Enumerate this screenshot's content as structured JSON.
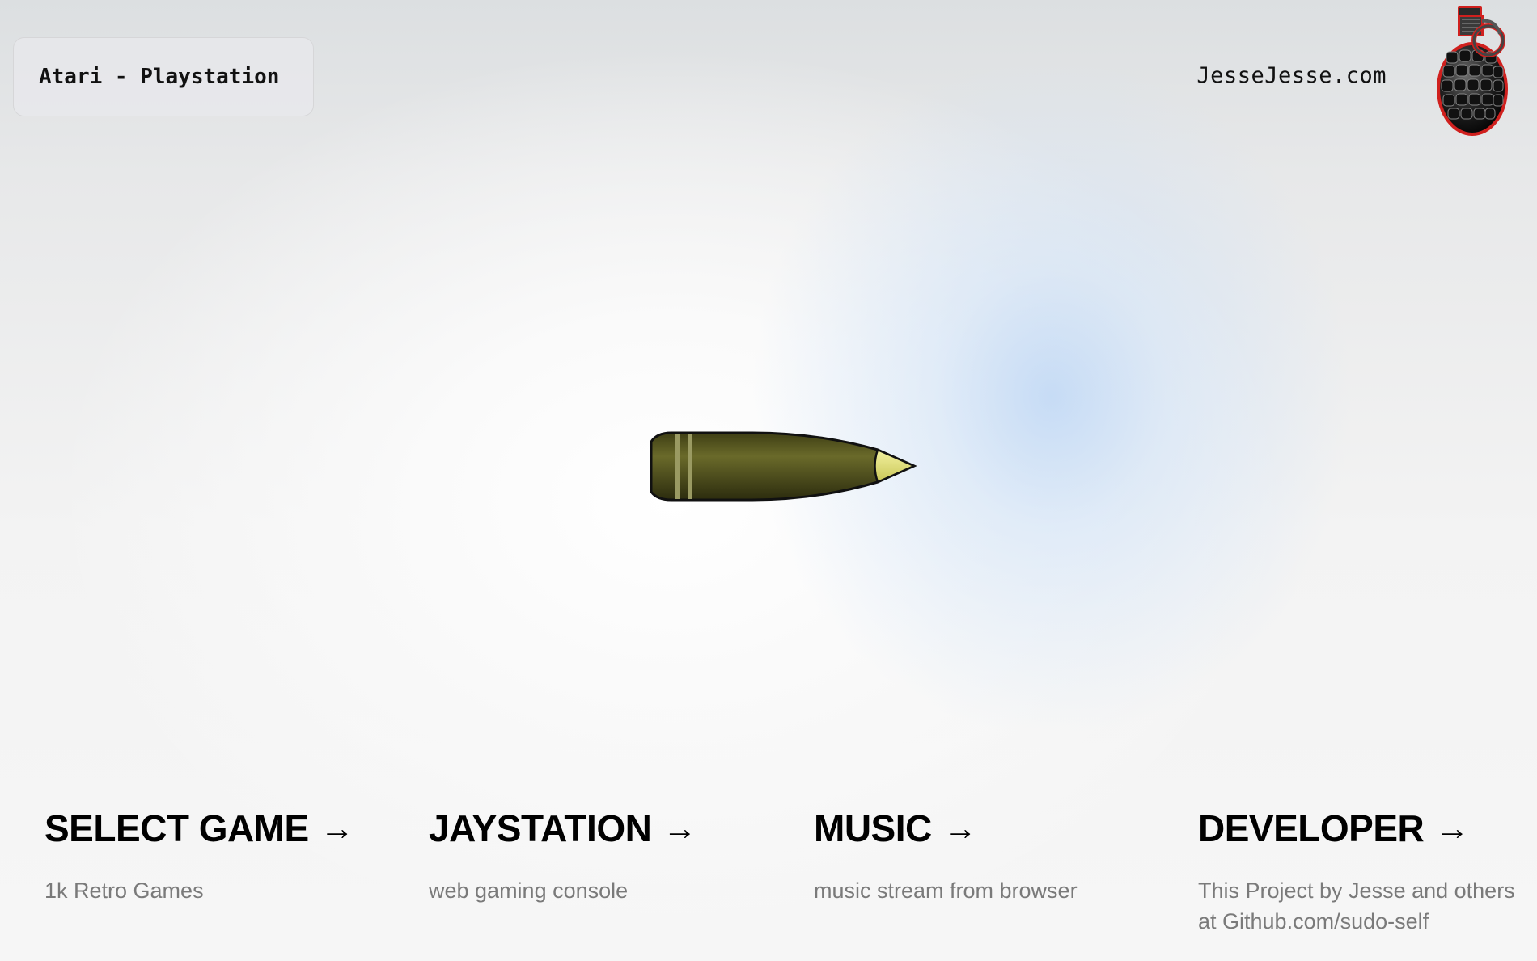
{
  "header": {
    "title": "Atari - Playstation",
    "site_link": "JesseJesse.com",
    "logo_icon": "grenade-icon"
  },
  "hero": {
    "icon": "bullet-icon"
  },
  "cards": [
    {
      "title": "SELECT GAME",
      "arrow": "→",
      "description": "1k Retro Games"
    },
    {
      "title": "JAYSTATION",
      "arrow": "→",
      "description": "web gaming console"
    },
    {
      "title": "MUSIC",
      "arrow": "→",
      "description": "music stream from browser"
    },
    {
      "title": "DEVELOPER",
      "arrow": "→",
      "description": "This Project by Jesse and others at Github.com/sudo-self"
    }
  ],
  "colors": {
    "text": "#000000",
    "muted": "#7a7a7a",
    "glow": "#cfe0f7",
    "bullet_body": "#5a5a1e",
    "bullet_tip": "#e8e77a",
    "grenade_outline": "#d0201e"
  }
}
